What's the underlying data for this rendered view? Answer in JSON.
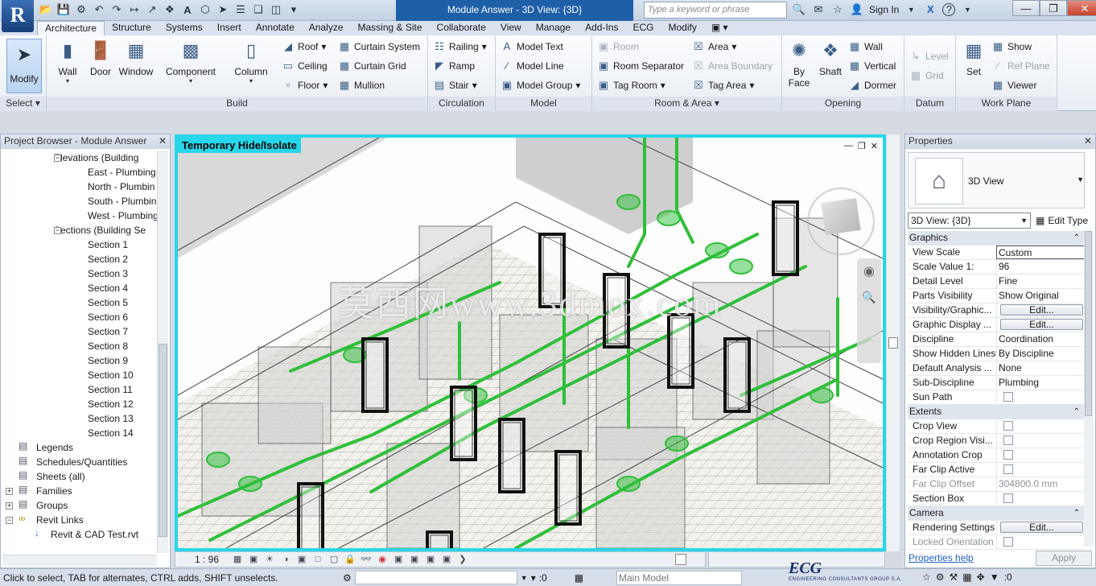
{
  "titlebar": {
    "app_letter": "R",
    "doc_title": "Module Answer - 3D View: {3D}",
    "search_placeholder": "Type a keyword or phrase",
    "sign_in": "Sign In",
    "help": "?"
  },
  "ribbon_tabs": [
    "Architecture",
    "Structure",
    "Systems",
    "Insert",
    "Annotate",
    "Analyze",
    "Massing & Site",
    "Collaborate",
    "View",
    "Manage",
    "Add-Ins",
    "ECG",
    "Modify"
  ],
  "ribbon": {
    "modify": "Modify",
    "select_panel": "Select",
    "build": {
      "label": "Build",
      "wall": "Wall",
      "door": "Door",
      "window": "Window",
      "component": "Component",
      "column": "Column",
      "roof": "Roof",
      "ceiling": "Ceiling",
      "floor": "Floor",
      "curtain_system": "Curtain System",
      "curtain_grid": "Curtain Grid",
      "mullion": "Mullion"
    },
    "circulation": {
      "label": "Circulation",
      "railing": "Railing",
      "ramp": "Ramp",
      "stair": "Stair"
    },
    "model": {
      "label": "Model",
      "model_text": "Model Text",
      "model_line": "Model Line",
      "model_group": "Model Group"
    },
    "room_area": {
      "label": "Room & Area",
      "room": "Room",
      "room_separator": "Room Separator",
      "tag_room": "Tag Room",
      "area": "Area",
      "area_boundary": "Area Boundary",
      "tag_area": "Tag Area"
    },
    "opening": {
      "label": "Opening",
      "by_face": "By Face",
      "shaft": "Shaft",
      "wall": "Wall",
      "vertical": "Vertical",
      "dormer": "Dormer"
    },
    "datum": {
      "label": "Datum",
      "level": "Level",
      "grid": "Grid"
    },
    "work_plane": {
      "label": "Work Plane",
      "set": "Set",
      "show": "Show",
      "ref_plane": "Ref  Plane",
      "viewer": "Viewer"
    }
  },
  "browser": {
    "title": "Project Browser - Module Answer",
    "items": [
      {
        "label": "Elevations (Building",
        "toggle": "−"
      },
      {
        "label": "East - Plumbing"
      },
      {
        "label": "North - Plumbin"
      },
      {
        "label": "South - Plumbin"
      },
      {
        "label": "West - Plumbing"
      },
      {
        "label": "Sections (Building Se",
        "toggle": "−"
      },
      {
        "label": "Section 1"
      },
      {
        "label": "Section 2"
      },
      {
        "label": "Section 3"
      },
      {
        "label": "Section 4"
      },
      {
        "label": "Section 5"
      },
      {
        "label": "Section 6"
      },
      {
        "label": "Section 7"
      },
      {
        "label": "Section 8"
      },
      {
        "label": "Section 9"
      },
      {
        "label": "Section 10"
      },
      {
        "label": "Section 11"
      },
      {
        "label": "Section 12"
      },
      {
        "label": "Section 13"
      },
      {
        "label": "Section 14"
      },
      {
        "label": "Legends"
      },
      {
        "label": "Schedules/Quantities"
      },
      {
        "label": "Sheets (all)"
      },
      {
        "label": "Families",
        "toggle": "+"
      },
      {
        "label": "Groups",
        "toggle": "+"
      },
      {
        "label": "Revit Links",
        "toggle": "−"
      },
      {
        "label": "Revit & CAD Test.rvt"
      }
    ]
  },
  "viewport": {
    "banner": "Temporary Hide/Isolate",
    "watermark": "莫西网www.3dmox.com",
    "scale": "1 : 96"
  },
  "properties": {
    "title": "Properties",
    "type_name": "3D View",
    "instance_selector": "3D View: {3D}",
    "edit_type": "Edit Type",
    "rows": [
      {
        "section": "Graphics"
      },
      {
        "key": "View Scale",
        "value": "Custom",
        "input": true
      },
      {
        "key": "Scale Value    1:",
        "value": "96"
      },
      {
        "key": "Detail Level",
        "value": "Fine"
      },
      {
        "key": "Parts Visibility",
        "value": "Show Original"
      },
      {
        "key": "Visibility/Graphic...",
        "button": "Edit..."
      },
      {
        "key": "Graphic Display ...",
        "button": "Edit..."
      },
      {
        "key": "Discipline",
        "value": "Coordination"
      },
      {
        "key": "Show Hidden Lines",
        "value": "By Discipline"
      },
      {
        "key": "Default Analysis ...",
        "value": "None"
      },
      {
        "key": "Sub-Discipline",
        "value": "Plumbing"
      },
      {
        "key": "Sun Path",
        "check": true
      },
      {
        "section": "Extents"
      },
      {
        "key": "Crop View",
        "check": true
      },
      {
        "key": "Crop Region Visi...",
        "check": true
      },
      {
        "key": "Annotation Crop",
        "check": true
      },
      {
        "key": "Far Clip Active",
        "check": true
      },
      {
        "key": "Far Clip Offset",
        "value": "304800.0 mm",
        "grey": true
      },
      {
        "key": "Section Box",
        "check": true
      },
      {
        "section": "Camera"
      },
      {
        "key": "Rendering Settings",
        "button": "Edit..."
      },
      {
        "key": "Locked Orientation",
        "check": true,
        "grey": true
      }
    ],
    "help_link": "Properties help",
    "apply": "Apply"
  },
  "statusbar": {
    "text": "Click to select, TAB for alternates, CTRL adds, SHIFT unselects.",
    "filter_count": ":0",
    "model": "Main Model",
    "logo": "ECG",
    "logo_sub": "ENGINEERING CONSULTANTS GROUP S.A.",
    "selection_count": ":0"
  },
  "colors": {
    "accent_cyan": "#27d6e8",
    "pipe_green": "#2fbf3a",
    "title_blue": "#1e5fa8"
  }
}
